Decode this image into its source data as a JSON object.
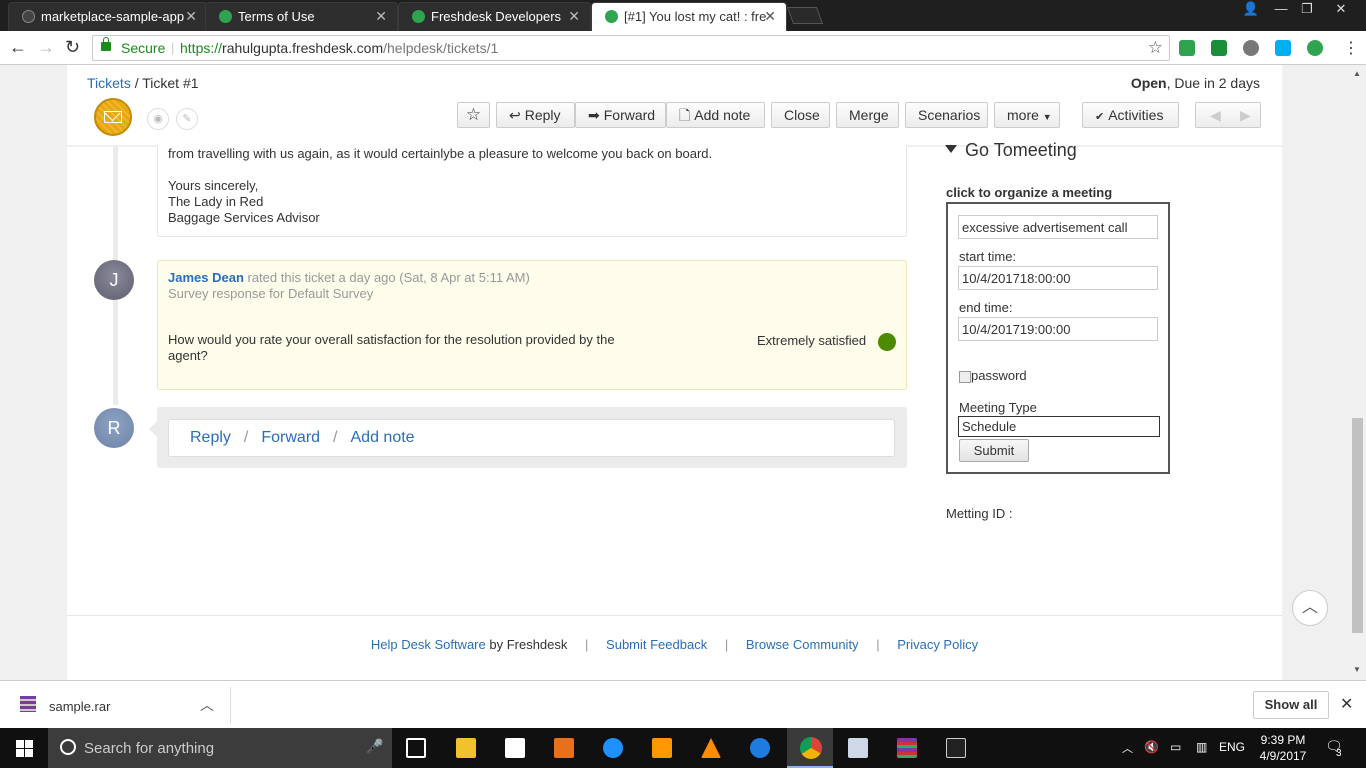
{
  "browser": {
    "tabs": [
      {
        "title": "marketplace-sample-app",
        "favicon_color": "#333333"
      },
      {
        "title": "Terms of Use",
        "favicon_color": "#2ea44f"
      },
      {
        "title": "Freshdesk Developers",
        "favicon_color": "#2ea44f"
      },
      {
        "title": "[#1] You lost my cat! : fre",
        "favicon_color": "#2ea44f",
        "active": true
      }
    ],
    "secure_label": "Secure",
    "url_scheme": "https://",
    "url_host": "rahulgupta.freshdesk.com",
    "url_path": "/helpdesk/tickets/1"
  },
  "ticket": {
    "breadcrumb_link": "Tickets",
    "breadcrumb_sep": "/",
    "breadcrumb_current": "Ticket #1",
    "status": "Open",
    "due": ", Due in 2 days"
  },
  "toolbar": {
    "reply": "Reply",
    "forward": "Forward",
    "add_note": "Add note",
    "close": "Close",
    "merge": "Merge",
    "scenarios": "Scenarios",
    "more": "more",
    "activities": "Activities"
  },
  "message": {
    "line1": "from travelling with us again, as it would certainlybe a pleasure to welcome you back on board.",
    "sign1": "Yours sincerely,",
    "sign2": "The Lady in Red",
    "sign3": "Baggage Services Advisor"
  },
  "survey": {
    "avatar_letter": "J",
    "author": "James Dean",
    "action": " rated this ticket a day ago (Sat, 8 Apr at 5:11 AM)",
    "subtitle": "Survey response for Default Survey",
    "question": "How would you rate your overall satisfaction for the resolution provided by the agent?",
    "answer": "Extremely satisfied",
    "answer_color": "#4e8a00"
  },
  "reply_box": {
    "avatar_letter": "R",
    "reply": "Reply",
    "forward": "Forward",
    "add_note": "Add note",
    "sep": "/"
  },
  "app": {
    "title": "Go Tomeeting",
    "organize_label": "click to organize a meeting",
    "subject_value": "excessive advertisement call",
    "start_label": "start time:",
    "start_value": "10/4/201718:00:00",
    "end_label": "end time:",
    "end_value": "10/4/201719:00:00",
    "password_label": "password",
    "meeting_type_label": "Meeting Type",
    "meeting_type_value": "Schedule",
    "submit": "Submit",
    "meeting_id_label": "Metting ID :"
  },
  "footer": {
    "helpdesk_link": "Help Desk Software",
    "by": " by Freshdesk",
    "feedback": "Submit Feedback",
    "community": "Browse Community",
    "privacy": "Privacy Policy",
    "sep": "|"
  },
  "download_bar": {
    "file": "sample.rar",
    "show_all": "Show all"
  },
  "taskbar": {
    "search_placeholder": "Search for anything",
    "lang": "ENG",
    "time": "9:39 PM",
    "date": "4/9/2017",
    "notifications": "3"
  }
}
